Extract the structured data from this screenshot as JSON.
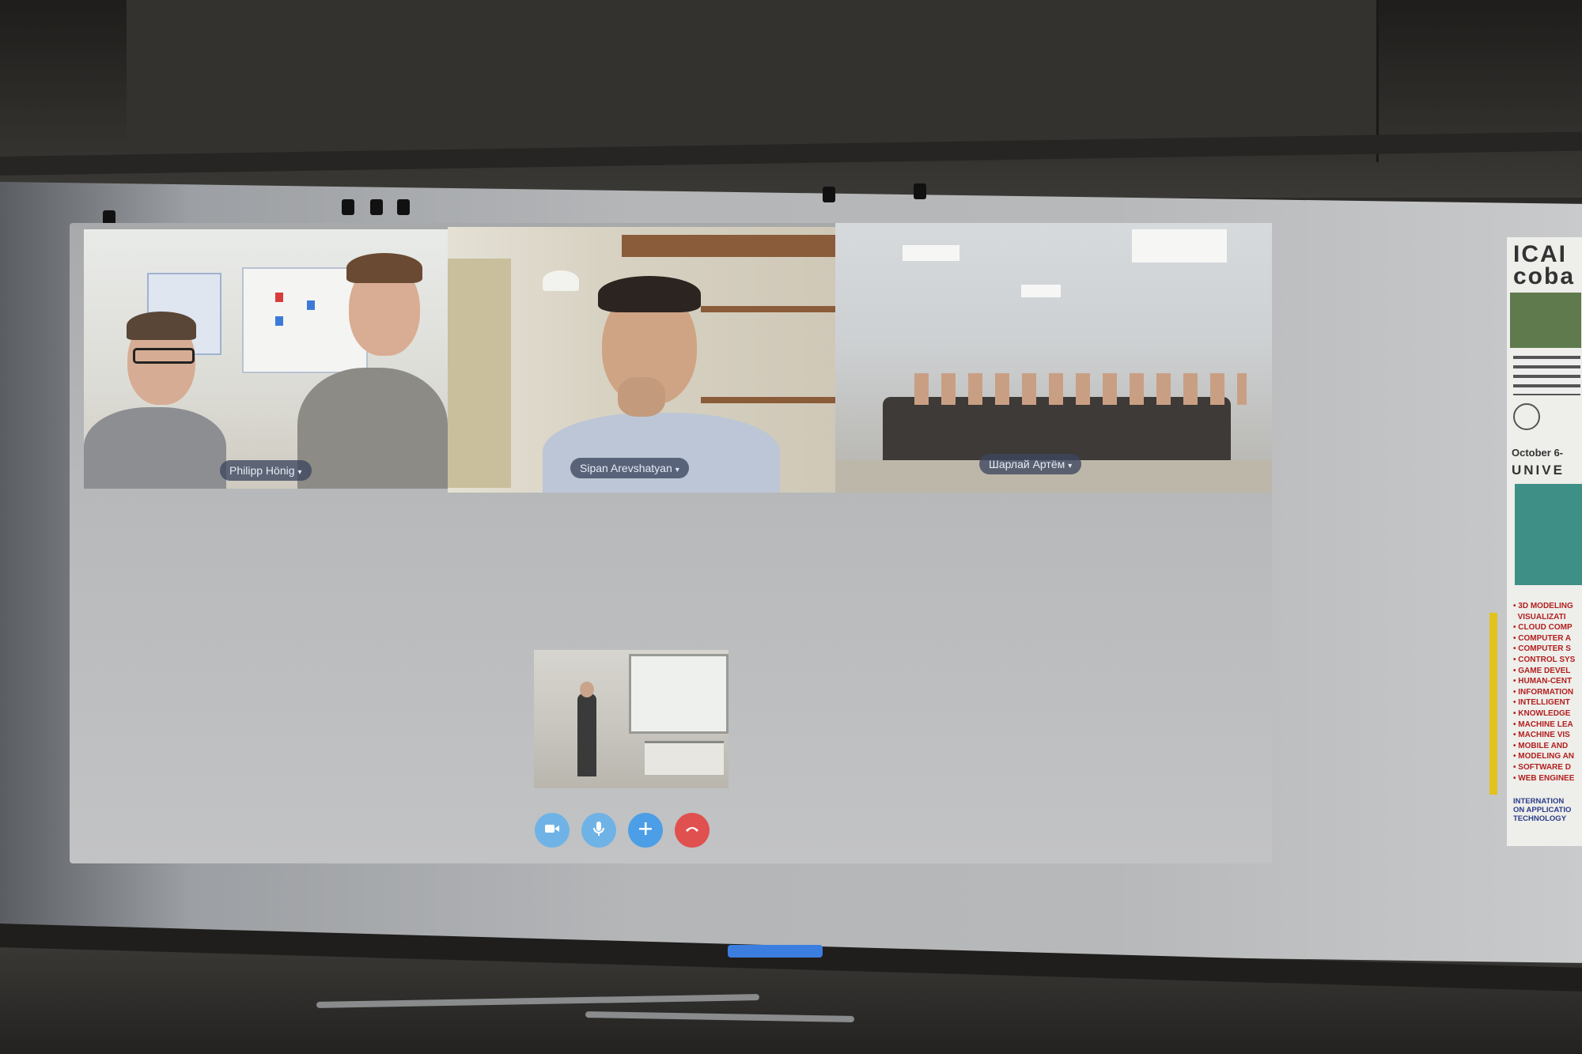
{
  "call": {
    "participants": [
      {
        "name": "Philipp Hönig",
        "chevron": "▾"
      },
      {
        "name": "Sipan Arevshatyan",
        "chevron": "▾"
      },
      {
        "name": "Шарлай Артём",
        "chevron": "▾"
      }
    ],
    "controls": [
      {
        "icon": "video-camera-icon",
        "color": "#6fb3e6"
      },
      {
        "icon": "microphone-icon",
        "color": "#6fb3e6"
      },
      {
        "icon": "add-icon",
        "color": "#4c9ee6"
      },
      {
        "icon": "hang-up-icon",
        "color": "#e0504f"
      }
    ]
  },
  "poster": {
    "header": "ICAI coba",
    "date": "October 6-",
    "university": "UNIVE",
    "topics": [
      "3D MODELING",
      "VISUALIZATI",
      "CLOUD COMP",
      "COMPUTER A",
      "COMPUTER S",
      "CONTROL SYS",
      "GAME DEVEL",
      "HUMAN-CENT",
      "INFORMATION",
      "INTELLIGENT",
      "KNOWLEDGE",
      "MACHINE LEA",
      "MACHINE VIS",
      "MOBILE AND",
      "MODELING AN",
      "SOFTWARE D",
      "WEB ENGINEE"
    ],
    "footer_lines": [
      "INTERNATION",
      "ON APPLICATIO",
      "TECHNOLOGY"
    ]
  }
}
